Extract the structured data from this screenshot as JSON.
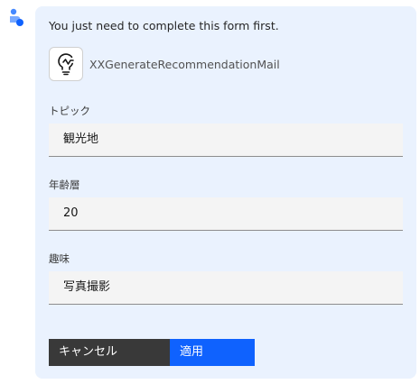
{
  "message": {
    "intro": "You just need to complete this form first."
  },
  "tool": {
    "icon": "lightbulb-icon",
    "name": "XXGenerateRecommendationMail"
  },
  "form": {
    "fields": [
      {
        "label": "トピック",
        "value": "観光地"
      },
      {
        "label": "年齢層",
        "value": "20"
      },
      {
        "label": "趣味",
        "value": "写真撮影"
      }
    ],
    "cancel_label": "キャンセル",
    "apply_label": "適用"
  },
  "colors": {
    "card_bg": "#eaf2fe",
    "primary": "#0f62fe",
    "secondary": "#393939",
    "avatar": "#4589ff"
  }
}
